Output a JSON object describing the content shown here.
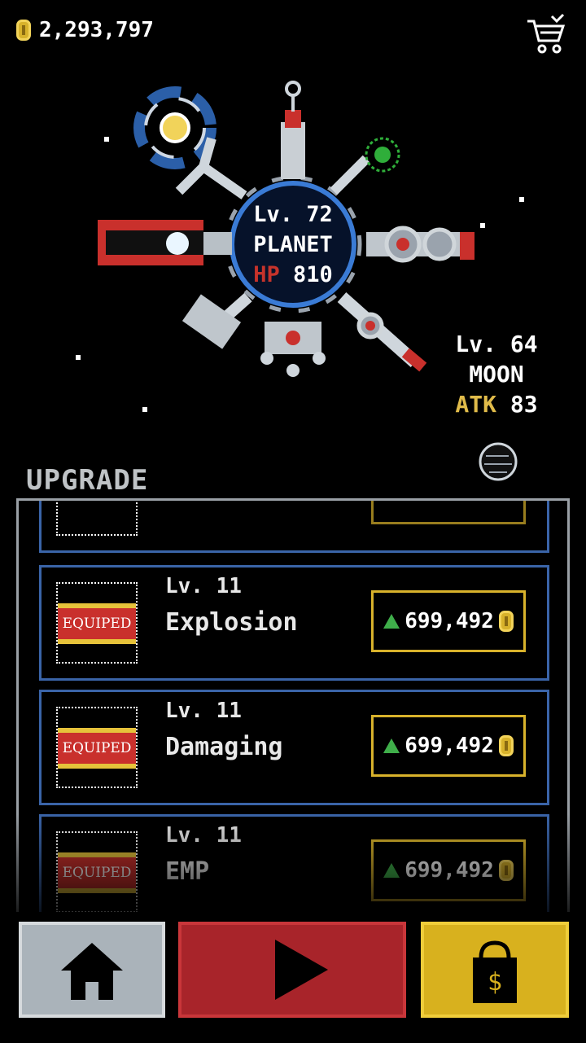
{
  "coins": "2,293,797",
  "planet": {
    "level": "Lv. 72",
    "name": "PLANET",
    "hp_label": "HP",
    "hp_value": "810"
  },
  "moon": {
    "level": "Lv. 64",
    "name": "MOON",
    "atk_label": "ATK",
    "atk_value": "83"
  },
  "upgrade": {
    "title": "UPGRADE",
    "items": [
      {
        "level": "Lv. 11",
        "name": "Explosion",
        "badge": "EQUIPED",
        "price": "699,492"
      },
      {
        "level": "Lv. 11",
        "name": "Damaging",
        "badge": "EQUIPED",
        "price": "699,492"
      },
      {
        "level": "Lv. 11",
        "name": "EMP",
        "badge": "EQUIPED",
        "price": "699,492"
      }
    ]
  },
  "colors": {
    "accent_gold": "#d8b22b",
    "hp_red": "#c6332b",
    "card_border": "#3a64a8",
    "play_red": "#a8242a"
  }
}
